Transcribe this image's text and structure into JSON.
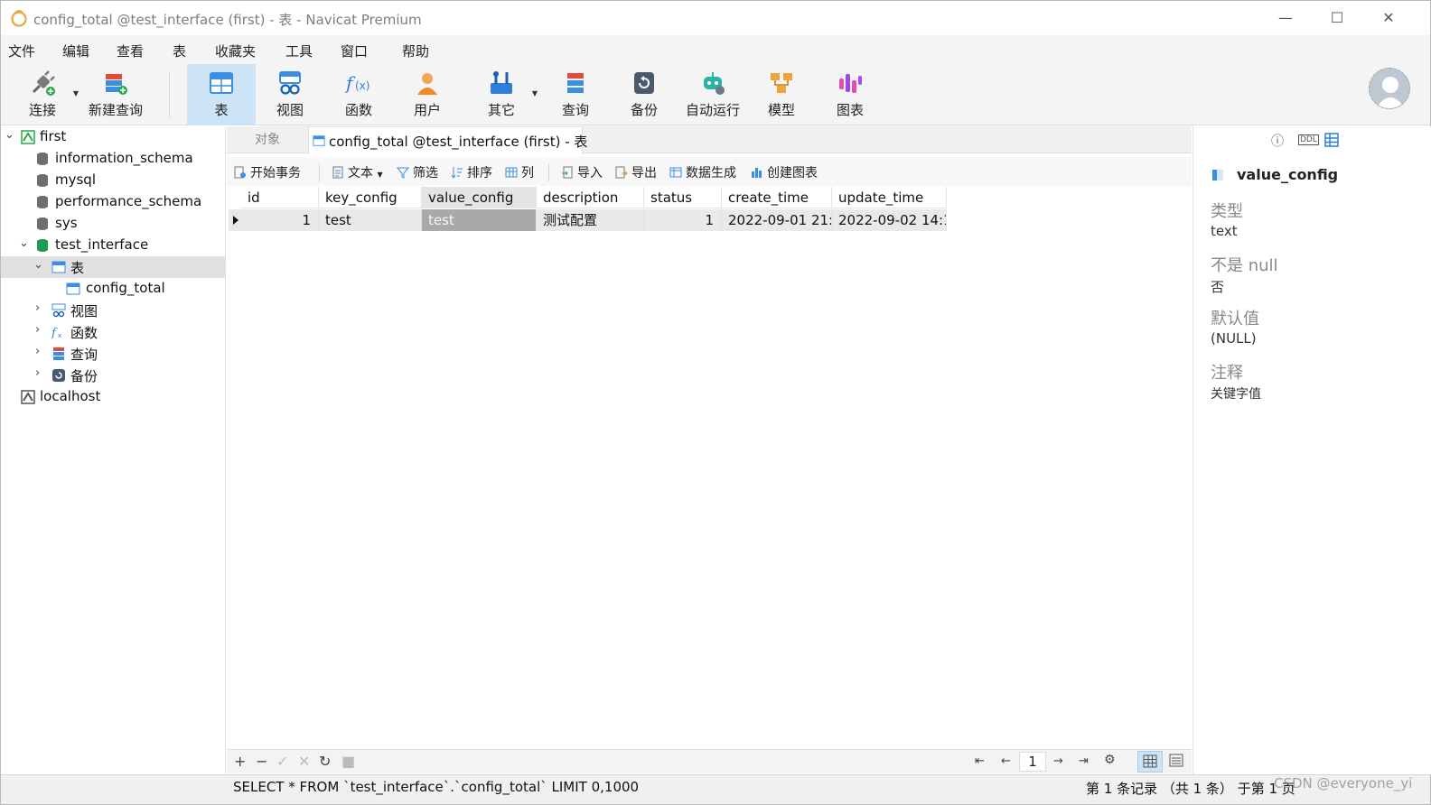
{
  "window": {
    "title": "config_total @test_interface (first) - 表 - Navicat Premium",
    "minimize": "—",
    "maximize": "☐",
    "close": "✕"
  },
  "menu": [
    "文件",
    "编辑",
    "查看",
    "表",
    "收藏夹",
    "工具",
    "窗口",
    "帮助"
  ],
  "toolbar": {
    "connect": "连接",
    "new_query": "新建查询",
    "table": "表",
    "view": "视图",
    "function": "函数",
    "user": "用户",
    "other": "其它",
    "query": "查询",
    "backup": "备份",
    "automation": "自动运行",
    "model": "模型",
    "chart": "图表"
  },
  "tree": {
    "first": "first",
    "information_schema": "information_schema",
    "mysql": "mysql",
    "performance_schema": "performance_schema",
    "sys": "sys",
    "test_interface": "test_interface",
    "tables": "表",
    "config_total": "config_total",
    "views": "视图",
    "functions": "函数",
    "queries": "查询",
    "backups": "备份",
    "localhost": "localhost"
  },
  "tabs": {
    "objects": "对象",
    "active": "config_total @test_interface (first) - 表"
  },
  "subtoolbar": {
    "begin_tx": "开始事务",
    "text": "文本",
    "filter": "筛选",
    "sort": "排序",
    "columns": "列",
    "import": "导入",
    "export": "导出",
    "data_gen": "数据生成",
    "create_chart": "创建图表"
  },
  "grid": {
    "headers": [
      "id",
      "key_config",
      "value_config",
      "description",
      "status",
      "create_time",
      "update_time"
    ],
    "row": [
      "1",
      "test",
      "test",
      "测试配置",
      "1",
      "2022-09-01 21:",
      "2022-09-02 14:1"
    ]
  },
  "bottom": {
    "page": "1"
  },
  "field_panel": {
    "name": "value_config",
    "type_label": "类型",
    "type_value": "text",
    "notnull_label": "不是 null",
    "notnull_value": "否",
    "default_label": "默认值",
    "default_value": "(NULL)",
    "comment_label": "注释",
    "comment_value": "关键字值"
  },
  "status": {
    "sql": "SELECT * FROM `test_interface`.`config_total` LIMIT 0,1000",
    "count": "第 1 条记录 （共 1 条） 于第 1 页",
    "watermark": "CSDN @everyone_yi"
  },
  "colors": {
    "accent": "#cde4f7",
    "selected_cell": "#a9a9a9",
    "db_green": "#1e9b4f"
  }
}
